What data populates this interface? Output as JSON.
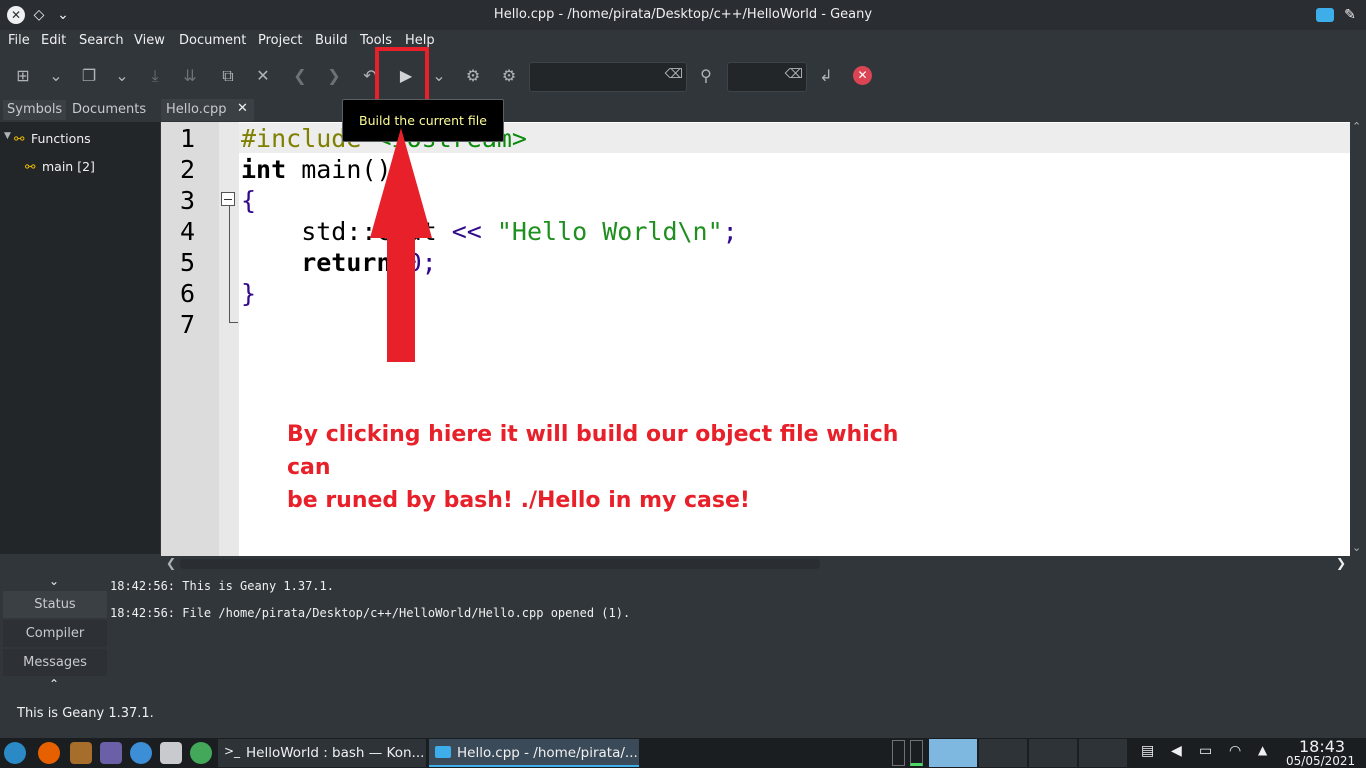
{
  "window": {
    "title": "Hello.cpp - /home/pirata/Desktop/c++/HelloWorld - Geany"
  },
  "menu": [
    "File",
    "Edit",
    "Search",
    "View",
    "Document",
    "Project",
    "Build",
    "Tools",
    "Help"
  ],
  "tooltip": "Build the current file",
  "sidebar": {
    "tabs": [
      "Symbols",
      "Documents"
    ],
    "tree": {
      "root": "Functions",
      "child": "main [2]"
    }
  },
  "editor": {
    "tab": "Hello.cpp",
    "line_numbers": [
      "1",
      "2",
      "3",
      "4",
      "5",
      "6",
      "7"
    ],
    "lines": [
      {
        "a": "#include",
        "b": " <iostream>"
      },
      {
        "a": "int",
        "b": " main()"
      },
      {
        "a": "{",
        "b": ""
      },
      {
        "a": "    std::cout ",
        "b": "<<",
        "c": " \"Hello World\\n\"",
        "d": ";"
      },
      {
        "a": "    return",
        "b": " 0",
        "c": ";"
      },
      {
        "a": "}",
        "b": ""
      },
      {
        "a": "",
        "b": ""
      }
    ]
  },
  "annotation": {
    "line1": "By clicking hiere it will build our object file which can",
    "line2": "be runed by bash! ./Hello in my case!"
  },
  "bottom_tabs": [
    "Status",
    "Compiler",
    "Messages"
  ],
  "log": [
    "18:42:56: This is Geany 1.37.1.",
    "18:42:56: File /home/pirata/Desktop/c++/HelloWorld/Hello.cpp opened (1)."
  ],
  "statusbar": "This is Geany 1.37.1.",
  "taskbar": {
    "tasks": [
      "HelloWorld : bash — Kon...",
      "Hello.cpp - /home/pirata/..."
    ],
    "clock": "18:43",
    "date": "05/05/2021"
  },
  "colors": {
    "annotation": "#e8202a",
    "tooltip_text": "#fdfd96"
  }
}
